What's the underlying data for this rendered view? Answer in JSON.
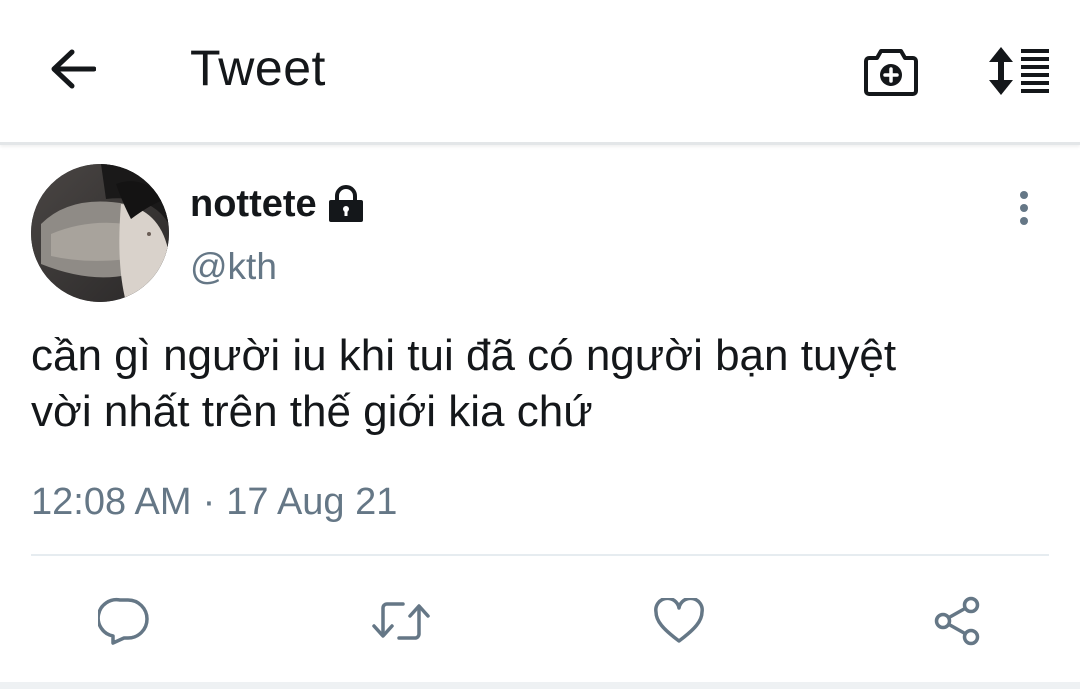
{
  "app_bar": {
    "title": "Tweet",
    "back_icon": "arrow-left-icon",
    "camera_icon": "camera-add-icon",
    "sort_icon": "sort-list-icon"
  },
  "tweet": {
    "display_name": "nottete",
    "protected_icon": "lock-icon",
    "handle": "@kth",
    "text": "cần gì người iu khi tui đã có người bạn tuyệt\nvời nhất trên thế giới kia chứ",
    "time": "12:08 AM",
    "separator": "·",
    "date": "17 Aug 21",
    "more_icon": "more-vertical-icon"
  },
  "actions": [
    {
      "name": "reply",
      "icon": "reply-bubble-icon"
    },
    {
      "name": "retweet",
      "icon": "retweet-icon"
    },
    {
      "name": "like",
      "icon": "heart-icon"
    },
    {
      "name": "share",
      "icon": "share-icon"
    }
  ],
  "colors": {
    "text_primary": "#14171a",
    "text_secondary": "#657786",
    "icon_action": "#657786",
    "divider": "#e6ecf0"
  }
}
